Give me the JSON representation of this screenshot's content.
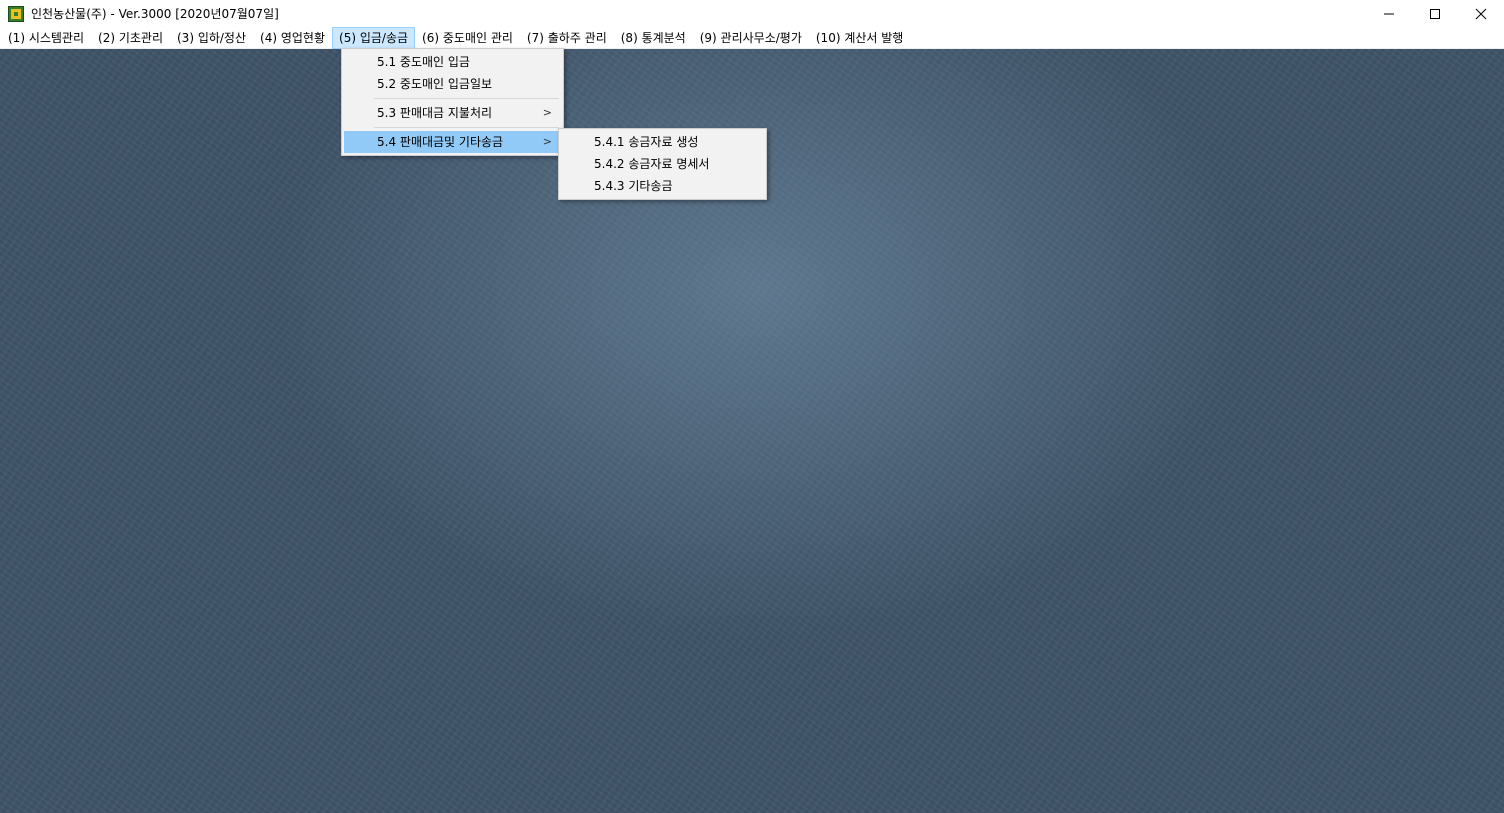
{
  "window": {
    "title": "인천농산물(주) - Ver.3000 [2020년07월07일]"
  },
  "menubar": {
    "items": [
      {
        "label": "(1) 시스템관리"
      },
      {
        "label": "(2) 기초관리"
      },
      {
        "label": "(3) 입하/정산"
      },
      {
        "label": "(4) 영업현황"
      },
      {
        "label": "(5) 입금/송금"
      },
      {
        "label": "(6) 중도매인 관리"
      },
      {
        "label": "(7) 출하주 관리"
      },
      {
        "label": "(8) 통계분석"
      },
      {
        "label": "(9) 관리사무소/평가"
      },
      {
        "label": "(10) 계산서 발행"
      }
    ]
  },
  "dropdown": {
    "items": [
      {
        "label": "5.1 중도매인 입금"
      },
      {
        "label": "5.2 중도매인 입금일보"
      },
      {
        "label": "5.3 판매대금 지불처리",
        "arrow": ">"
      },
      {
        "label": "5.4 판매대금및 기타송금",
        "arrow": ">"
      }
    ]
  },
  "submenu": {
    "items": [
      {
        "label": "5.4.1 송금자료 생성"
      },
      {
        "label": "5.4.2 송금자료 명세서"
      },
      {
        "label": "5.4.3 기타송금"
      }
    ]
  },
  "icons": {
    "app": "app-logo-icon",
    "minimize": "minimize-icon",
    "maximize": "maximize-icon",
    "close": "close-icon"
  },
  "colors": {
    "menu_active_bg": "#cce8ff",
    "menu_highlight_bg": "#91c9f7",
    "desktop_bg": "#3f5468"
  }
}
